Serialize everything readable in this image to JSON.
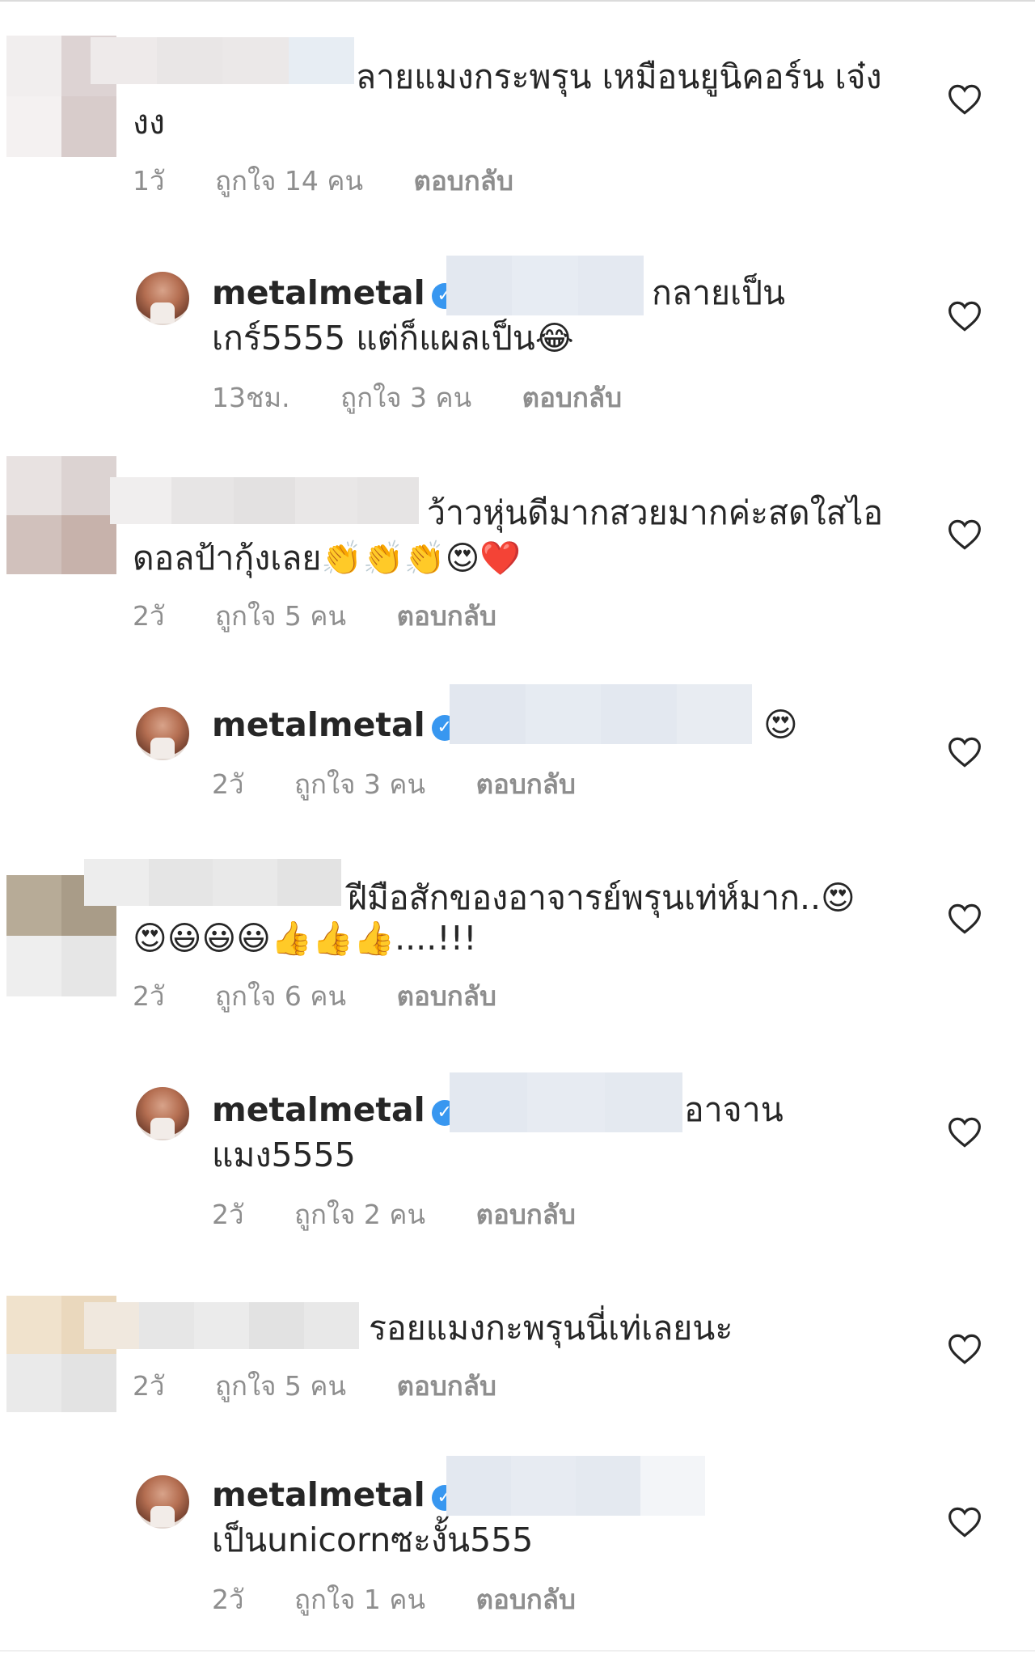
{
  "comments": [
    {
      "text_line1": "ลายแมงกระพรุน เหมือนยูนิคอร์น เจ๋ง",
      "text_line2": "งง",
      "time": "1วั",
      "likes": "ถูกใจ 14 คน",
      "reply": "ตอบกลับ"
    },
    {
      "username": "metalmetal",
      "text_line1": "กลายเป็น",
      "text_line2": "เกร์5555 แต่ก็แผลเป็น😂",
      "time": "13ชม.",
      "likes": "ถูกใจ 3 คน",
      "reply": "ตอบกลับ"
    },
    {
      "text_line1": "ว้าวหุ่นดีมากสวยมากค่ะสดใสไอ",
      "text_line2": "ดอลป้ากุ้งเลย👏👏👏😍❤️",
      "time": "2วั",
      "likes": "ถูกใจ 5 คน",
      "reply": "ตอบกลับ"
    },
    {
      "username": "metalmetal",
      "text_line1": "😍",
      "time": "2วั",
      "likes": "ถูกใจ 3 คน",
      "reply": "ตอบกลับ"
    },
    {
      "text_line1": "ฝีมือสักของอาจารย์พรุนเท่ห์มาก..😍",
      "text_line2": "😍😃😃😃👍👍👍....!!!",
      "time": "2วั",
      "likes": "ถูกใจ 6 คน",
      "reply": "ตอบกลับ"
    },
    {
      "username": "metalmetal",
      "text_line1": "อาจาน",
      "text_line2": "แมง5555",
      "time": "2วั",
      "likes": "ถูกใจ 2 คน",
      "reply": "ตอบกลับ"
    },
    {
      "text_line1": "รอยแมงกะพรุนนี่เท่เลยนะ",
      "time": "2วั",
      "likes": "ถูกใจ 5 คน",
      "reply": "ตอบกลับ"
    },
    {
      "username": "metalmetal",
      "text_line2": "เป็นunicornซะงั้น555",
      "time": "2วั",
      "likes": "ถูกใจ 1 คน",
      "reply": "ตอบกลับ"
    }
  ],
  "verified_mark": "✓",
  "colors": {
    "text": "#262626",
    "meta": "#8e8e8e",
    "verified": "#3897f0",
    "blur_mention": "#e4e9f1"
  }
}
